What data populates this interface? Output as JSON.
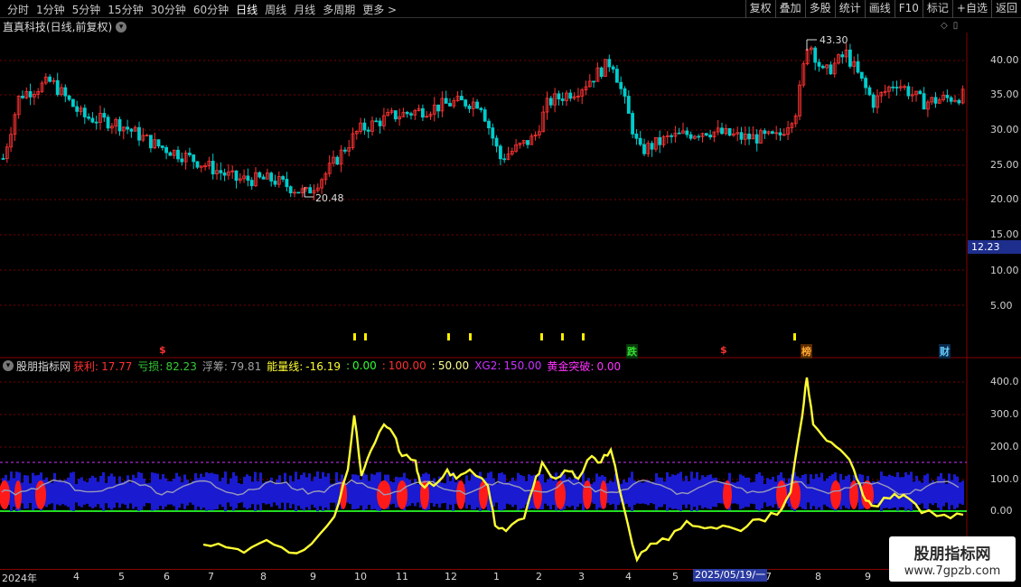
{
  "toolbar": {
    "periods": [
      "分时",
      "1分钟",
      "5分钟",
      "15分钟",
      "30分钟",
      "60分钟",
      "日线",
      "周线",
      "月线",
      "多周期",
      "更多 >"
    ],
    "actions": [
      "复权",
      "叠加",
      "多股",
      "统计",
      "画线",
      "F10",
      "标记",
      "+自选",
      "返回"
    ]
  },
  "main_chart": {
    "title": "直真科技(日线,前复权)",
    "y_ticks": [
      "40.00",
      "35.00",
      "30.00",
      "25.00",
      "20.00",
      "15.00",
      "10.00",
      "5.00"
    ],
    "current_price": "12.23",
    "high_label": "43.30",
    "low_label": "20.48",
    "event_markers": [
      {
        "text": "$",
        "color": "#ff3333"
      },
      {
        "text": "跌",
        "color": "#33dd33"
      },
      {
        "text": "$",
        "color": "#ff3333"
      },
      {
        "text": "榜",
        "color": "#ffaa33"
      },
      {
        "text": "财",
        "color": "#66ccff"
      }
    ]
  },
  "indicator": {
    "name": "股朋指标网",
    "items": [
      {
        "label": "获利:",
        "value": "17.77",
        "color": "#ff3030"
      },
      {
        "label": "亏损:",
        "value": "82.23",
        "color": "#33cc33"
      },
      {
        "label": "浮筹:",
        "value": "79.81",
        "color": "#a0a0a0"
      },
      {
        "label": "能量线:",
        "value": "-16.19",
        "color": "#ffff33"
      },
      {
        "label": ":",
        "value": "0.00",
        "color": "#33ff33"
      },
      {
        "label": ":",
        "value": "100.00",
        "color": "#ff3030"
      },
      {
        "label": ":",
        "value": "50.00",
        "color": "#ffff99"
      },
      {
        "label": "XG2:",
        "value": "150.00",
        "color": "#cc33ff"
      },
      {
        "label": "黄金突破:",
        "value": "0.00",
        "color": "#ff33ff"
      }
    ],
    "y_ticks": [
      "400.0",
      "300.0",
      "200.0",
      "100.0",
      "0.00"
    ]
  },
  "date_axis": {
    "labels": [
      "2024年",
      "4",
      "5",
      "6",
      "7",
      "8",
      "9",
      "10",
      "11",
      "12",
      "1",
      "2",
      "3",
      "4",
      "5",
      "7",
      "8",
      "9"
    ],
    "cursor_date": "2025/05/19/一"
  },
  "watermark": {
    "line1": "股朋指标网",
    "line2": "www.7gpzb.com"
  },
  "colors": {
    "up": "#ff3333",
    "down": "#00cccc",
    "energy": "#ffff33",
    "grid": "#7a0000",
    "bar_blue": "#1a1ad0"
  }
}
